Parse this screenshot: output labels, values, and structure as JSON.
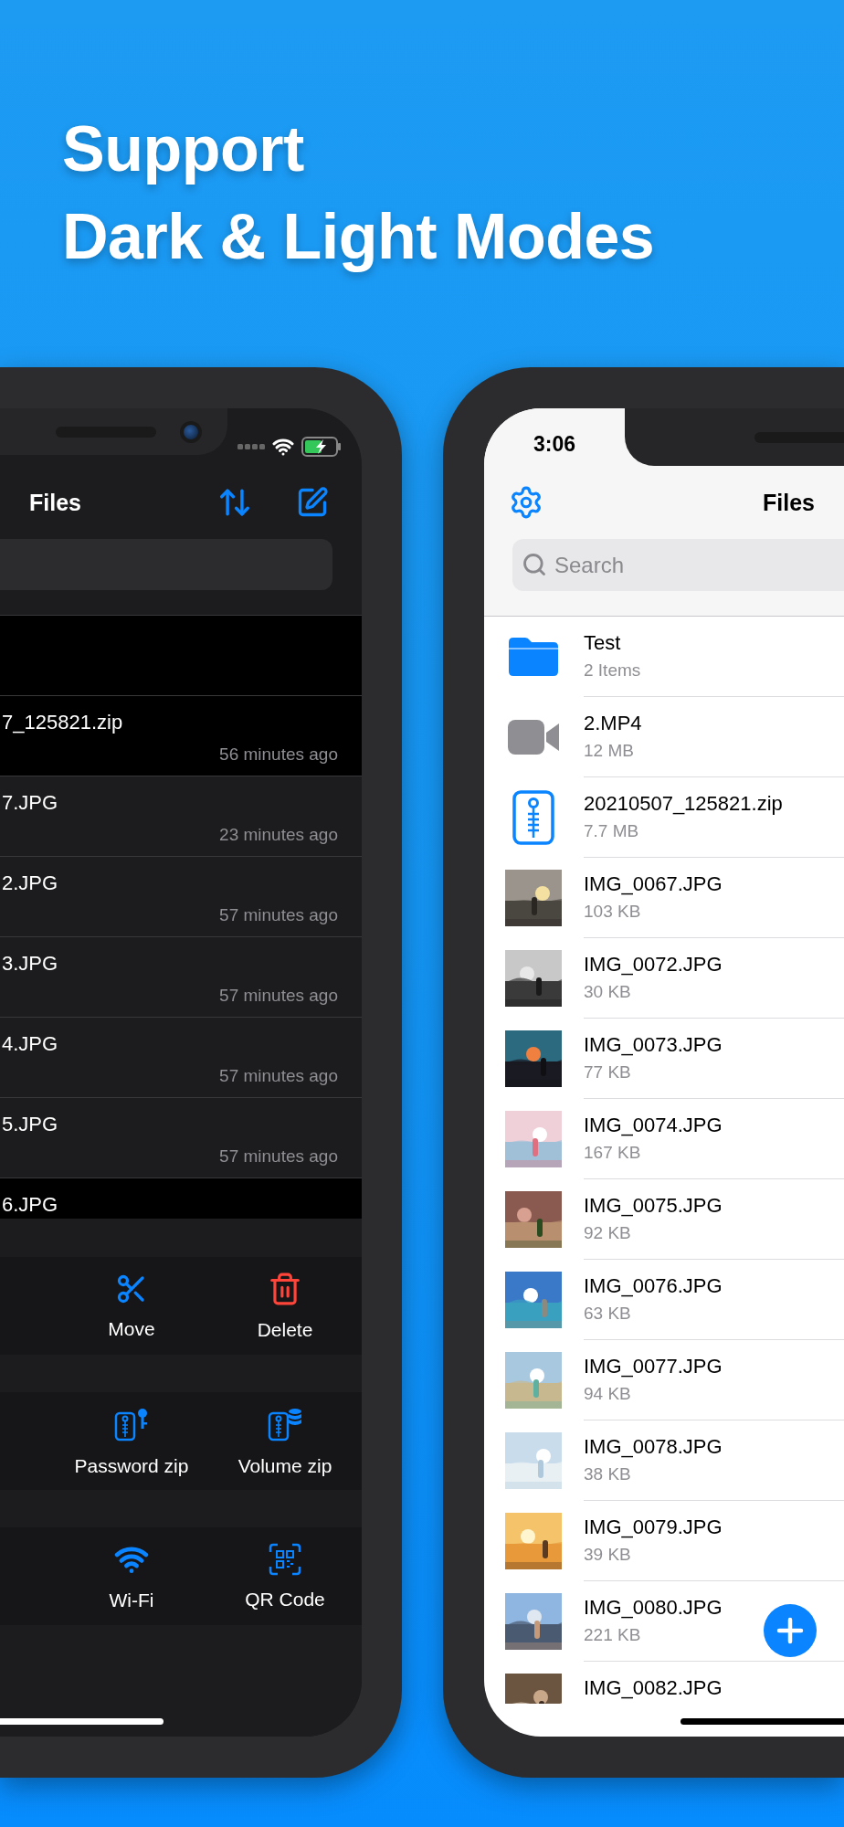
{
  "headline": [
    "Support",
    "Dark & Light Modes"
  ],
  "dark_phone": {
    "title": "Files",
    "rows": [
      {
        "selected": true
      },
      {
        "name": "7_125821.zip",
        "time": "56 minutes ago",
        "selected": true
      },
      {
        "name": "7.JPG",
        "time": "23 minutes ago",
        "selected": false
      },
      {
        "name": "2.JPG",
        "time": "57 minutes ago",
        "selected": false
      },
      {
        "name": "3.JPG",
        "time": "57 minutes ago",
        "selected": false
      },
      {
        "name": "4.JPG",
        "time": "57 minutes ago",
        "selected": false
      },
      {
        "name": "5.JPG",
        "time": "57 minutes ago",
        "selected": false
      },
      {
        "name": "6.JPG",
        "selected": true
      }
    ],
    "action_groups": [
      [
        {
          "kind": "move",
          "label": "Move"
        },
        {
          "kind": "delete",
          "label": "Delete"
        }
      ],
      [
        {
          "kind": "password_zip",
          "label": "Password zip"
        },
        {
          "kind": "volume_zip",
          "label": "Volume zip"
        }
      ],
      [
        {
          "kind": "wifi",
          "label": "Wi-Fi"
        },
        {
          "kind": "qr_code",
          "label": "QR Code"
        }
      ]
    ]
  },
  "light_phone": {
    "time": "3:06",
    "title": "Files",
    "search": {
      "placeholder": "Search"
    },
    "rows": [
      {
        "kind": "folder",
        "name": "Test",
        "detail": "2 Items"
      },
      {
        "kind": "video",
        "name": "2.MP4",
        "detail": "12 MB"
      },
      {
        "kind": "zip",
        "name": "20210507_125821.zip",
        "detail": "7.7 MB"
      },
      {
        "kind": "picture",
        "name": "IMG_0067.JPG",
        "detail": "103 KB"
      },
      {
        "kind": "picture",
        "name": "IMG_0072.JPG",
        "detail": "30 KB"
      },
      {
        "kind": "picture",
        "name": "IMG_0073.JPG",
        "detail": "77 KB"
      },
      {
        "kind": "picture",
        "name": "IMG_0074.JPG",
        "detail": "167 KB"
      },
      {
        "kind": "picture",
        "name": "IMG_0075.JPG",
        "detail": "92 KB"
      },
      {
        "kind": "picture",
        "name": "IMG_0076.JPG",
        "detail": "63 KB"
      },
      {
        "kind": "picture",
        "name": "IMG_0077.JPG",
        "detail": "94 KB"
      },
      {
        "kind": "picture",
        "name": "IMG_0078.JPG",
        "detail": "38 KB"
      },
      {
        "kind": "picture",
        "name": "IMG_0079.JPG",
        "detail": "39 KB"
      },
      {
        "kind": "picture",
        "name": "IMG_0080.JPG",
        "detail": "221 KB"
      },
      {
        "kind": "picture",
        "name": "IMG_0082.JPG"
      }
    ]
  }
}
